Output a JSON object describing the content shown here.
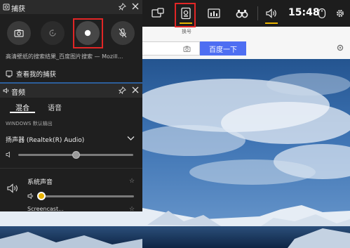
{
  "topbar": {
    "icons": [
      "widget-menu-icon",
      "capture-widget-icon",
      "performance-icon",
      "looking-for-group-icon",
      "audio-icon",
      "mouse-icon",
      "settings-icon"
    ],
    "time": "15:48",
    "accent": "#e9b300",
    "highlight": "#e12626"
  },
  "browser": {
    "search_button": "百度一下",
    "partial_text": "换号"
  },
  "capture": {
    "title": "捕获",
    "caption": "高清壁纸的搜索结果_百度图片搜索 — Mozill...",
    "see_captures": "查看我的捕获",
    "buttons": [
      "screenshot-icon",
      "record-last-30s-icon",
      "start-recording-icon",
      "mic-off-icon"
    ]
  },
  "audio": {
    "title": "音频",
    "tabs": [
      "混合",
      "语音"
    ],
    "section_label": "WINDOWS 默认输出",
    "device": "扬声器 (Realtek(R) Audio)",
    "device_volume": 0.5,
    "app_name": "系统声音",
    "app_volume": 0.03,
    "next_app_partial": "Screencast..."
  }
}
